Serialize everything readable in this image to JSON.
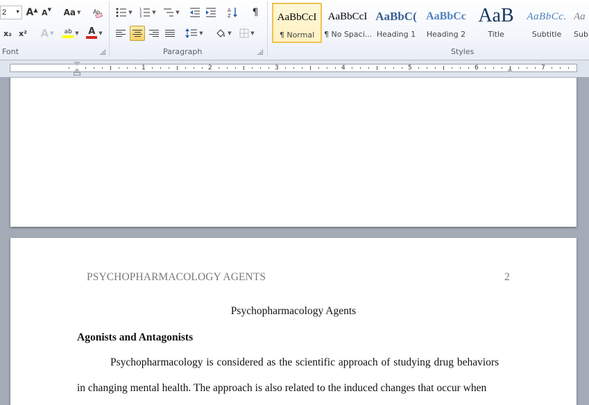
{
  "font_group": {
    "size_value": "2",
    "grow_label": "A",
    "shrink_label": "A",
    "change_case_label": "Aa",
    "subscript_label": "x₂",
    "superscript_label": "x²",
    "text_effects_label": "A",
    "highlight_label": "ab",
    "font_color_label": "A",
    "group_label": "Font"
  },
  "paragraph_group": {
    "sort_label": "A↓Z",
    "show_marks_label": "¶",
    "group_label": "Paragraph",
    "center_active": true
  },
  "styles_group": {
    "group_label": "Styles",
    "items": [
      {
        "preview": "AaBbCcI",
        "name": "¶ Normal"
      },
      {
        "preview": "AaBbCcI",
        "name": "¶ No Spaci..."
      },
      {
        "preview": "AaBbC(",
        "name": "Heading 1"
      },
      {
        "preview": "AaBbCc",
        "name": "Heading 2"
      },
      {
        "preview": "AaB",
        "name": "Title"
      },
      {
        "preview": "AaBbCc.",
        "name": "Subtitle"
      },
      {
        "preview": "Aa",
        "name": "Sub"
      }
    ]
  },
  "ruler": {
    "numbers": [
      "1",
      "2",
      "3",
      "4",
      "5",
      "6",
      "7"
    ]
  },
  "document": {
    "header_title": "PSYCHOPHARMACOLOGY AGENTS",
    "page_number": "2",
    "title": "Psychopharmacology Agents",
    "heading": "Agonists and Antagonists",
    "lines": [
      "Psychopharmacology is considered as the scientific approach of studying drug behaviors",
      "in changing mental health. The approach is also related to the induced changes that occur when"
    ]
  },
  "colors": {
    "accent_yellow": "#f0c24d",
    "heading_blue": "#365f91",
    "font_red": "#d3281f",
    "highlight_yellow": "#ffff00"
  }
}
